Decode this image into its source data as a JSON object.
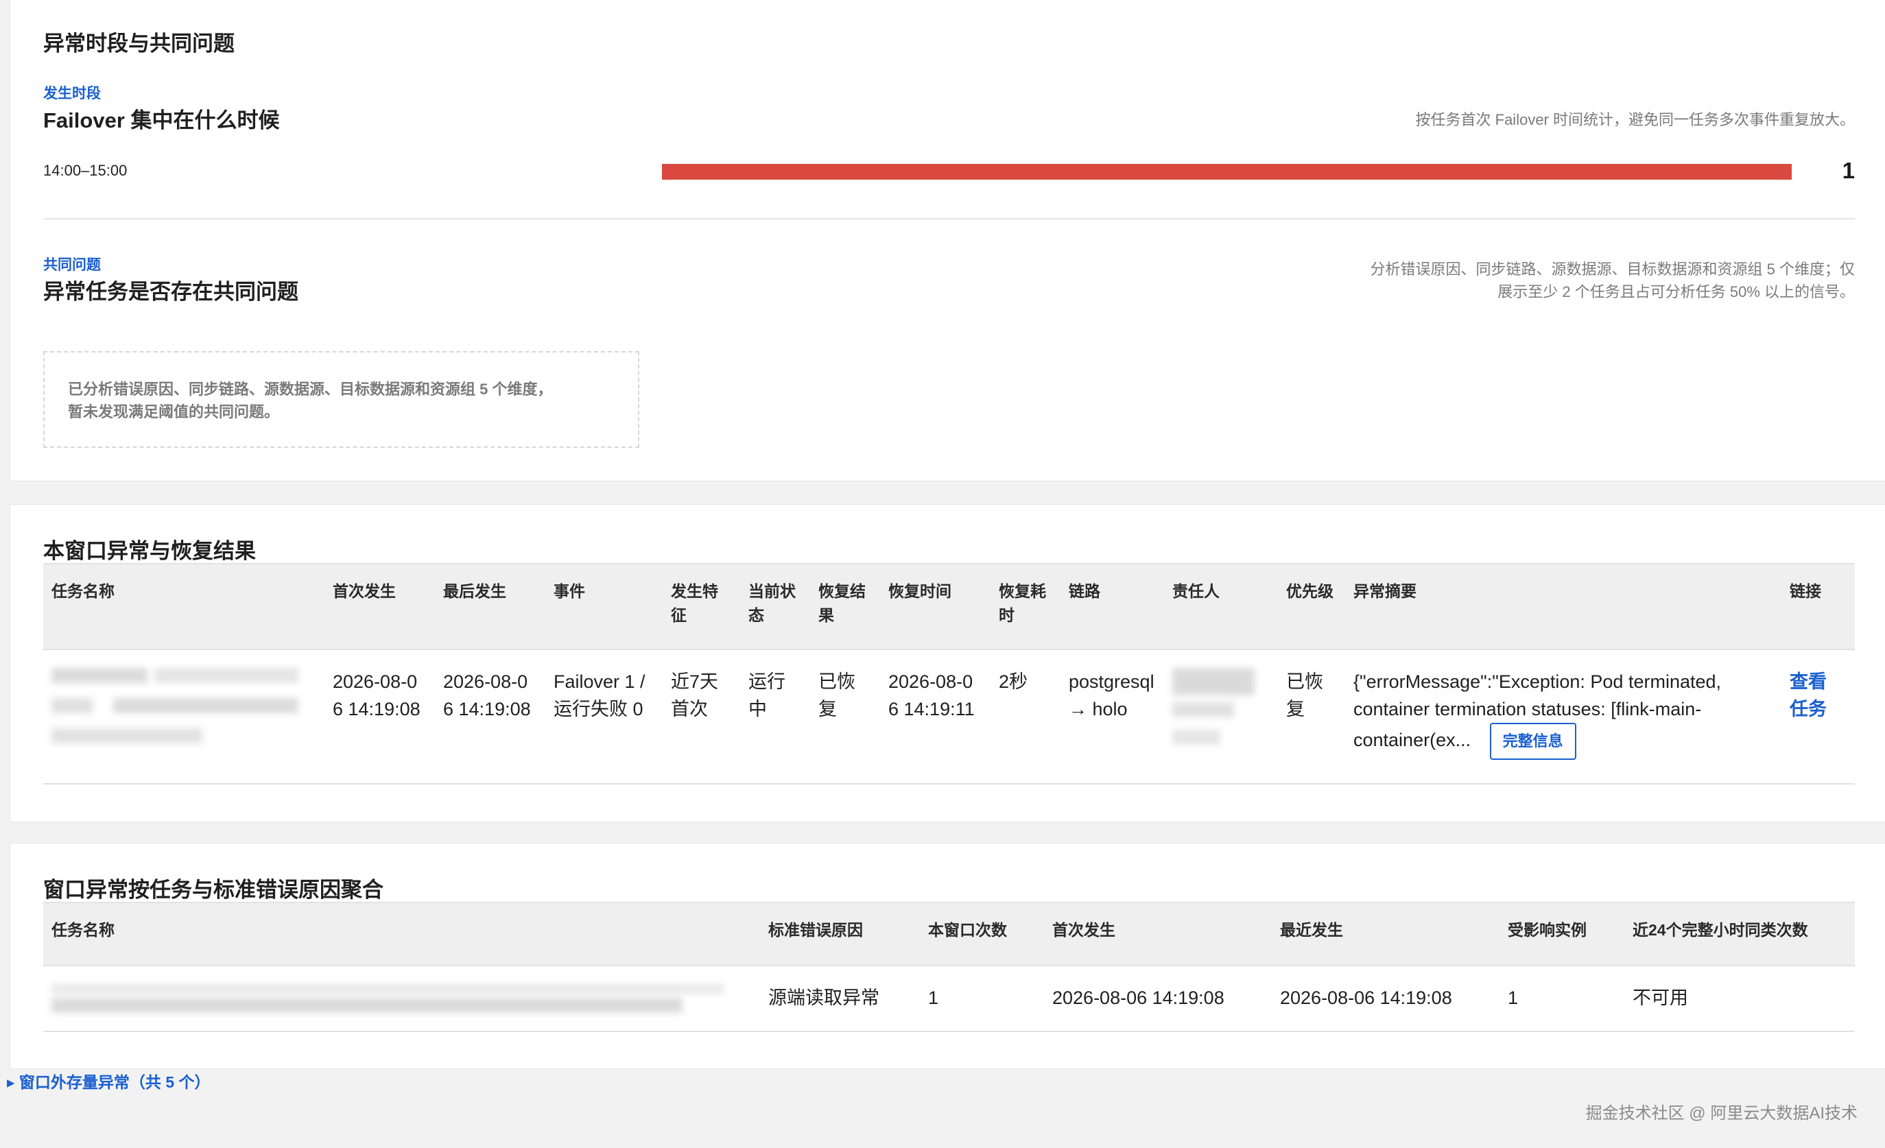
{
  "section1": {
    "title": "异常时段与共同问题",
    "period": {
      "eyebrow": "发生时段",
      "title": "Failover 集中在什么时候",
      "hint": "按任务首次 Failover 时间统计，避免同一任务多次事件重复放大。",
      "rows": [
        {
          "label": "14:00–15:00",
          "count": "1",
          "fraction": 1.0
        }
      ]
    },
    "common": {
      "eyebrow": "共同问题",
      "title": "异常任务是否存在共同问题",
      "hint_line1": "分析错误原因、同步链路、源数据源、目标数据源和资源组 5 个维度；仅",
      "hint_line2": "展示至少 2 个任务且占可分析任务 50% 以上的信号。",
      "empty_line1": "已分析错误原因、同步链路、源数据源、目标数据源和资源组 5 个维度，",
      "empty_line2": "暂未发现满足阈值的共同问题。"
    }
  },
  "section2": {
    "title": "本窗口异常与恢复结果",
    "columns": {
      "task": "任务名称",
      "first": "首次发生",
      "last": "最后发生",
      "event": "事件",
      "feature": "发生特征",
      "state": "当前状态",
      "result": "恢复结果",
      "recover_time": "恢复时间",
      "recover_cost": "恢复耗时",
      "link": "链路",
      "owner": "责任人",
      "priority": "优先级",
      "summary": "异常摘要",
      "url": "链接"
    },
    "row": {
      "first": "2026-08-06 14:19:08",
      "last": "2026-08-06 14:19:08",
      "event": "Failover 1 / 运行失败 0",
      "feature": "近7天首次",
      "state": "运行中",
      "result": "已恢复",
      "recover_time": "2026-08-06 14:19:11",
      "recover_cost": "2秒",
      "link": "postgresql → holo",
      "priority": "已恢复",
      "summary": "{\"errorMessage\":\"Exception: Pod terminated, container termination statuses: [flink-main-container(ex...",
      "full_info": "完整信息",
      "view_task": "查看任务"
    }
  },
  "section3": {
    "title": "窗口异常按任务与标准错误原因聚合",
    "columns": {
      "task": "任务名称",
      "reason": "标准错误原因",
      "count": "本窗口次数",
      "first": "首次发生",
      "recent": "最近发生",
      "instances": "受影响实例",
      "day_count": "近24个完整小时同类次数"
    },
    "row": {
      "reason": "源端读取异常",
      "count": "1",
      "first": "2026-08-06 14:19:08",
      "recent": "2026-08-06 14:19:08",
      "instances": "1",
      "day_count": "不可用"
    }
  },
  "details_toggle": "▸ 窗口外存量异常（共 5 个）",
  "footer": "掘金技术社区 @ 阿里云大数据AI技术",
  "colors": {
    "accent": "#1a5fd0",
    "bar": "#d9493f"
  }
}
